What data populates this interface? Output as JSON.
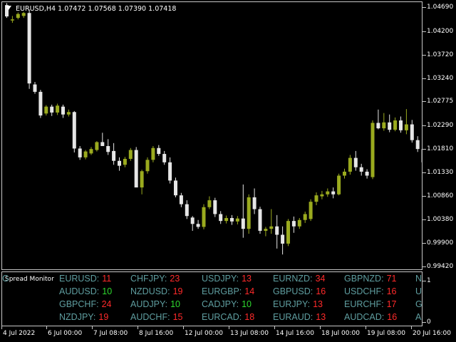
{
  "symbol_info": {
    "symbol": "EURUSD,H4",
    "open": "1.07472",
    "high": "1.07568",
    "low": "1.07390",
    "close": "1.07418"
  },
  "price_axis": {
    "labels": [
      "1.04690",
      "1.04200",
      "1.03720",
      "1.03240",
      "1.02775",
      "1.02290",
      "1.01810",
      "1.01330",
      "1.00860",
      "1.00380",
      "0.99900",
      "0.99420"
    ],
    "range": [
      0.9935,
      1.048
    ]
  },
  "time_axis": {
    "labels": [
      "4 Jul 2022",
      "6 Jul 00:00",
      "7 Jul 08:00",
      "8 Jul 16:00",
      "12 Jul 00:00",
      "13 Jul 08:00",
      "14 Jul 16:00",
      "18 Jul 00:00",
      "19 Jul 08:00",
      "20 Jul 16:00"
    ]
  },
  "colors": {
    "background": "#000000",
    "grid_frame": "#c8c8c8",
    "bull_candle": "#9aaa1e",
    "bear_candle": "#e6e6e6",
    "pair_text": "#5f9ea0",
    "spread_high": "#ff2a2a",
    "spread_low": "#2ed82e"
  },
  "candles": [
    [
      1.0474,
      1.0478,
      1.0448,
      1.0451
    ],
    [
      1.0443,
      1.0452,
      1.0438,
      1.0445
    ],
    [
      1.0448,
      1.0459,
      1.0445,
      1.0456
    ],
    [
      1.0452,
      1.046,
      1.0448,
      1.0458
    ],
    [
      1.0458,
      1.0465,
      1.0304,
      1.0315
    ],
    [
      1.0313,
      1.0318,
      1.0294,
      1.0298
    ],
    [
      1.0298,
      1.0302,
      1.0245,
      1.025
    ],
    [
      1.0254,
      1.0271,
      1.025,
      1.0268
    ],
    [
      1.0268,
      1.0272,
      1.0249,
      1.0256
    ],
    [
      1.0256,
      1.0274,
      1.0251,
      1.027
    ],
    [
      1.0268,
      1.0272,
      1.0245,
      1.0252
    ],
    [
      1.0252,
      1.0262,
      1.0248,
      1.0257
    ],
    [
      1.0257,
      1.0259,
      1.0175,
      1.0183
    ],
    [
      1.0183,
      1.0188,
      1.016,
      1.0165
    ],
    [
      1.0165,
      1.018,
      1.0161,
      1.0177
    ],
    [
      1.0173,
      1.0186,
      1.017,
      1.0182
    ],
    [
      1.018,
      1.0198,
      1.0177,
      1.0196
    ],
    [
      1.0196,
      1.0215,
      1.019,
      1.0188
    ],
    [
      1.0188,
      1.0202,
      1.017,
      1.0176
    ],
    [
      1.0178,
      1.0194,
      1.015,
      1.0158
    ],
    [
      1.0158,
      1.0165,
      1.0138,
      1.0148
    ],
    [
      1.015,
      1.0166,
      1.0145,
      1.0162
    ],
    [
      1.0162,
      1.0184,
      1.0158,
      1.018
    ],
    [
      1.018,
      1.0186,
      1.0118,
      1.0104
    ],
    [
      1.0104,
      1.014,
      1.009,
      1.0137
    ],
    [
      1.0137,
      1.0165,
      1.0132,
      1.016
    ],
    [
      1.016,
      1.0188,
      1.0155,
      1.0184
    ],
    [
      1.0184,
      1.019,
      1.0168,
      1.0172
    ],
    [
      1.0172,
      1.0178,
      1.015,
      1.0155
    ],
    [
      1.0155,
      1.0165,
      1.0112,
      1.0118
    ],
    [
      1.0118,
      1.0124,
      1.0084,
      1.0088
    ],
    [
      1.0088,
      1.0093,
      1.0064,
      1.007
    ],
    [
      1.007,
      1.0078,
      1.004,
      1.0046
    ],
    [
      1.0043,
      1.0046,
      1.0016,
      1.003
    ],
    [
      1.003,
      1.0038,
      1.002,
      1.0024
    ],
    [
      1.0024,
      1.007,
      1.0019,
      1.0064
    ],
    [
      1.0064,
      1.0086,
      1.006,
      1.0078
    ],
    [
      1.0078,
      1.0083,
      1.0044,
      1.005
    ],
    [
      1.005,
      1.0056,
      1.003,
      1.0036
    ],
    [
      1.0036,
      1.0047,
      1.0031,
      1.0042
    ],
    [
      1.0042,
      1.0048,
      1.0028,
      1.0035
    ],
    [
      1.0035,
      1.0046,
      1.0029,
      1.0041
    ],
    [
      1.0041,
      1.011,
      1.0002,
      1.002
    ],
    [
      1.002,
      1.009,
      1.001,
      1.0084
    ],
    [
      1.0084,
      1.0102,
      1.005,
      1.006
    ],
    [
      1.006,
      1.0065,
      1.001,
      1.0016
    ],
    [
      1.0016,
      1.0024,
      1.0005,
      1.002
    ],
    [
      1.002,
      1.006,
      1.001,
      1.0025
    ],
    [
      1.0025,
      1.0048,
      0.998,
      1.0008
    ],
    [
      1.0008,
      1.0025,
      0.9968,
      0.999
    ],
    [
      0.999,
      1.004,
      0.9985,
      1.0036
    ],
    [
      1.0036,
      1.0045,
      1.0012,
      1.0025
    ],
    [
      1.0025,
      1.0042,
      1.002,
      1.0038
    ],
    [
      1.0038,
      1.0055,
      1.0032,
      1.005
    ],
    [
      1.004,
      1.008,
      1.0036,
      1.0075
    ],
    [
      1.0075,
      1.0094,
      1.0068,
      1.0088
    ],
    [
      1.0086,
      1.0097,
      1.008,
      1.009
    ],
    [
      1.009,
      1.0102,
      1.0085,
      1.0096
    ],
    [
      1.0096,
      1.0104,
      1.0082,
      1.009
    ],
    [
      1.009,
      1.0132,
      1.0088,
      1.0128
    ],
    [
      1.0128,
      1.0142,
      1.0122,
      1.0136
    ],
    [
      1.0136,
      1.017,
      1.013,
      1.0164
    ],
    [
      1.0164,
      1.0178,
      1.0138,
      1.0145
    ],
    [
      1.0145,
      1.0152,
      1.0128,
      1.0136
    ],
    [
      1.0136,
      1.0141,
      1.0122,
      1.0128
    ],
    [
      1.0125,
      1.024,
      1.0121,
      1.0235
    ],
    [
      1.0235,
      1.0262,
      1.0222,
      1.0224
    ],
    [
      1.0224,
      1.0255,
      1.0219,
      1.0236
    ],
    [
      1.0236,
      1.0252,
      1.0216,
      1.0221
    ],
    [
      1.0221,
      1.0246,
      1.0218,
      1.024
    ],
    [
      1.024,
      1.0248,
      1.0215,
      1.022
    ],
    [
      1.022,
      1.0263,
      1.0212,
      1.0232
    ],
    [
      1.0232,
      1.0241,
      1.0195,
      1.02
    ],
    [
      1.02,
      1.0208,
      1.0176,
      1.0182
    ],
    [
      1.0182,
      1.019,
      1.0148,
      1.0155
    ]
  ],
  "indicator": {
    "title": "Spread Monitor",
    "axis_labels": [
      "1",
      "0"
    ],
    "spreads": [
      {
        "pair": "EURUSD:",
        "value": "11",
        "state": "high"
      },
      {
        "pair": "AUDUSD:",
        "value": "10",
        "state": "low"
      },
      {
        "pair": "GBPCHF:",
        "value": "24",
        "state": "high"
      },
      {
        "pair": "NZDJPY:",
        "value": "19",
        "state": "high"
      },
      {
        "pair": "CHFJPY:",
        "value": "23",
        "state": "high"
      },
      {
        "pair": "NZDUSD:",
        "value": "19",
        "state": "high"
      },
      {
        "pair": "AUDJPY:",
        "value": "10",
        "state": "low"
      },
      {
        "pair": "AUDCHF:",
        "value": "15",
        "state": "high"
      },
      {
        "pair": "USDJPY:",
        "value": "13",
        "state": "high"
      },
      {
        "pair": "EURGBP:",
        "value": "14",
        "state": "high"
      },
      {
        "pair": "CADJPY:",
        "value": "10",
        "state": "low"
      },
      {
        "pair": "EURCAD:",
        "value": "18",
        "state": "high"
      },
      {
        "pair": "EURNZD:",
        "value": "34",
        "state": "high"
      },
      {
        "pair": "GBPUSD:",
        "value": "16",
        "state": "high"
      },
      {
        "pair": "EURJPY:",
        "value": "13",
        "state": "high"
      },
      {
        "pair": "EURAUD:",
        "value": "13",
        "state": "high"
      },
      {
        "pair": "GBPNZD:",
        "value": "71",
        "state": "high"
      },
      {
        "pair": "USDCHF:",
        "value": "16",
        "state": "high"
      },
      {
        "pair": "EURCHF:",
        "value": "17",
        "state": "high"
      },
      {
        "pair": "AUDCAD:",
        "value": "16",
        "state": "high"
      },
      {
        "pair": "NZDCHF:",
        "value": "19",
        "state": "high"
      },
      {
        "pair": "U",
        "value": "",
        "state": "high"
      },
      {
        "pair": "G",
        "value": "",
        "state": "high"
      },
      {
        "pair": "A",
        "value": "",
        "state": "high"
      },
      {
        "pair": "G",
        "value": "",
        "state": "high"
      }
    ]
  }
}
